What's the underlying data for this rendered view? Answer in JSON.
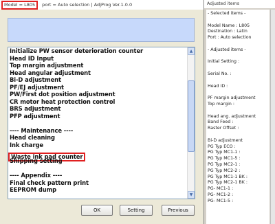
{
  "main_window": {
    "title_model": "Model = L805",
    "title_rest": "port = Auto selection | AdjProg Ver.1.0.0",
    "list_items": [
      "Initialize PW sensor deterioration counter",
      "Head ID Input",
      "Top margin adjustment",
      "Head angular adjustment",
      "Bi-D adjustment",
      "PF/EJ adjustment",
      "PW/First dot position adjustment",
      "CR motor heat protection control",
      "BRS adjustment",
      "PFP adjustment",
      "",
      "---- Maintenance ----",
      "Head cleaning",
      "Ink charge",
      "Waste ink pad counter",
      "Shipping setting",
      "",
      "---- Appendix ----",
      "Final check pattern print",
      "EEPROM dump"
    ],
    "highlighted_index": 14,
    "buttons": {
      "ok": "OK",
      "setting": "Setting",
      "previous": "Previous"
    },
    "scrollbar": {
      "up_icon": "▲",
      "down_icon": "▼"
    }
  },
  "side_panel": {
    "title": "Adjusted items",
    "lines": [
      "- Selected items -",
      "",
      "Model Name : L805",
      "Destination : Latin",
      "Port : Auto selection",
      "",
      "- Adjusted items -",
      "",
      "Initial Setting :",
      "",
      "Serial No. :",
      "",
      "Head ID :",
      "",
      "PF margin adjustment",
      "Top margin :",
      "",
      "Head ang. adjustment",
      "Band Feed :",
      "Raster Offset :",
      "",
      "Bi-D adjustment",
      "  PG Typ ECO :",
      "  PG Typ MC1-1 :",
      "  PG Typ MC1-5 :",
      "  PG Typ MC2-1 :",
      "  PG Typ MC2-2 :",
      "  PG Typ MC1-1 BK :",
      "  PG Typ MC2-1 BK :",
      "  PG- MC1-1 :",
      "  PG- MC1-2 :",
      "  PG- MC1-5 :"
    ]
  },
  "colors": {
    "highlight_border": "#e02020",
    "info_box": "#c7d9fb"
  }
}
